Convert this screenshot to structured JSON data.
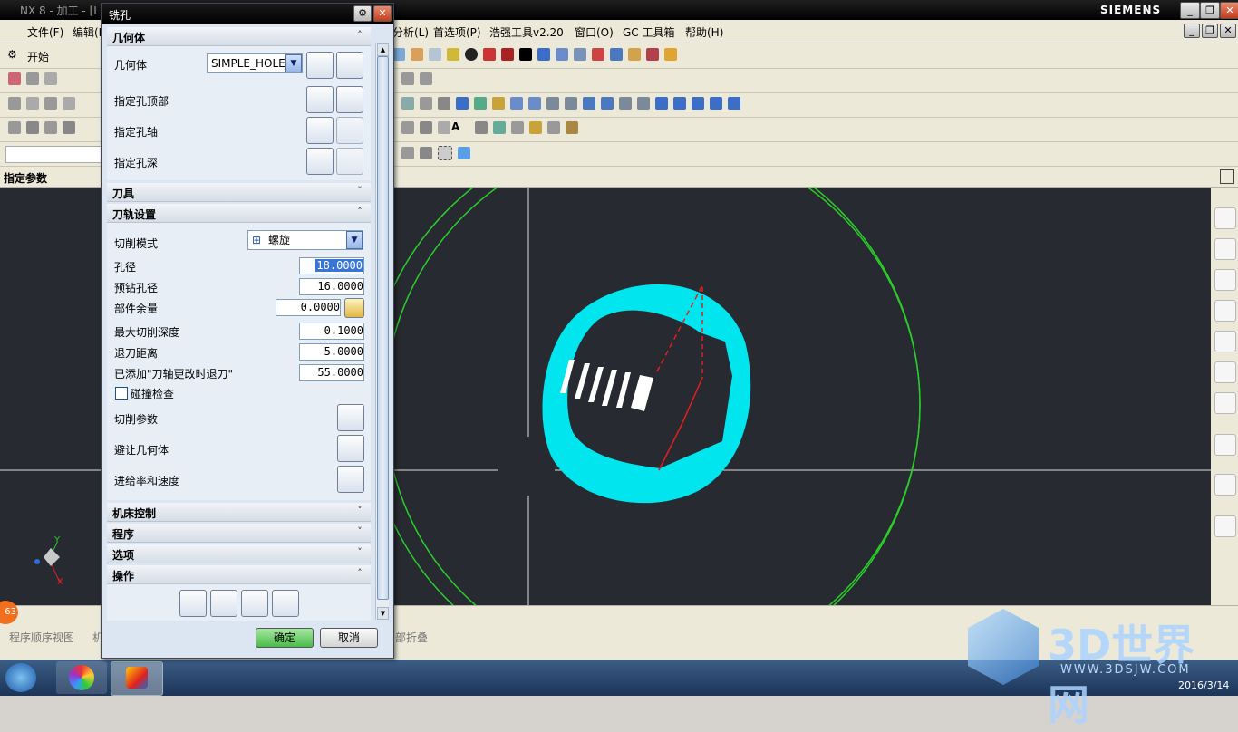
{
  "main_window": {
    "title": "NX 8 - 加工 - [L",
    "brand": "SIEMENS",
    "controls": [
      "_",
      "❐",
      "✕"
    ],
    "menu": [
      "文件(F)",
      "编辑(E)",
      "分析(L)",
      "首选项(P)",
      "浩强工具v2.20",
      "窗口(O)",
      "GC 工具箱",
      "帮助(H)"
    ],
    "start_label": "开始",
    "status_prompt": "指定参数",
    "bottom_tabs": [
      "程序顺序视图",
      "机",
      "部折叠"
    ],
    "badge": "63",
    "axis_y": "Y",
    "axis_x": "X"
  },
  "dialog": {
    "title": "铣孔",
    "sections": {
      "geometry": "几何体",
      "tool": "刀具",
      "path_settings": "刀轨设置",
      "machine_control": "机床控制",
      "program": "程序",
      "options": "选项",
      "actions": "操作"
    },
    "geometry": {
      "label": "几何体",
      "value": "SIMPLE_HOLE",
      "hole_top": "指定孔顶部",
      "hole_axis": "指定孔轴",
      "hole_depth": "指定孔深"
    },
    "path": {
      "cut_mode_label": "切削模式",
      "cut_mode_value": "螺旋",
      "hole_dia_label": "孔径",
      "hole_dia": "18.0000",
      "predrill_label": "预钻孔径",
      "predrill": "16.0000",
      "stock_label": "部件余量",
      "stock": "0.0000",
      "max_depth_label": "最大切削深度",
      "max_depth": "0.1000",
      "retract_label": "退刀距离",
      "retract": "5.0000",
      "added_retract_label": "已添加\"刀轴更改时退刀\"",
      "added_retract": "55.0000",
      "collision_label": "碰撞检查",
      "cut_params_label": "切削参数",
      "avoid_label": "避让几何体",
      "feeds_label": "进给率和速度"
    },
    "ok": "确定",
    "cancel": "取消"
  },
  "taskbar": {
    "date": "2016/3/14",
    "watermark": "3D世界网",
    "watermark_url": "WWW.3DSJW.COM"
  }
}
